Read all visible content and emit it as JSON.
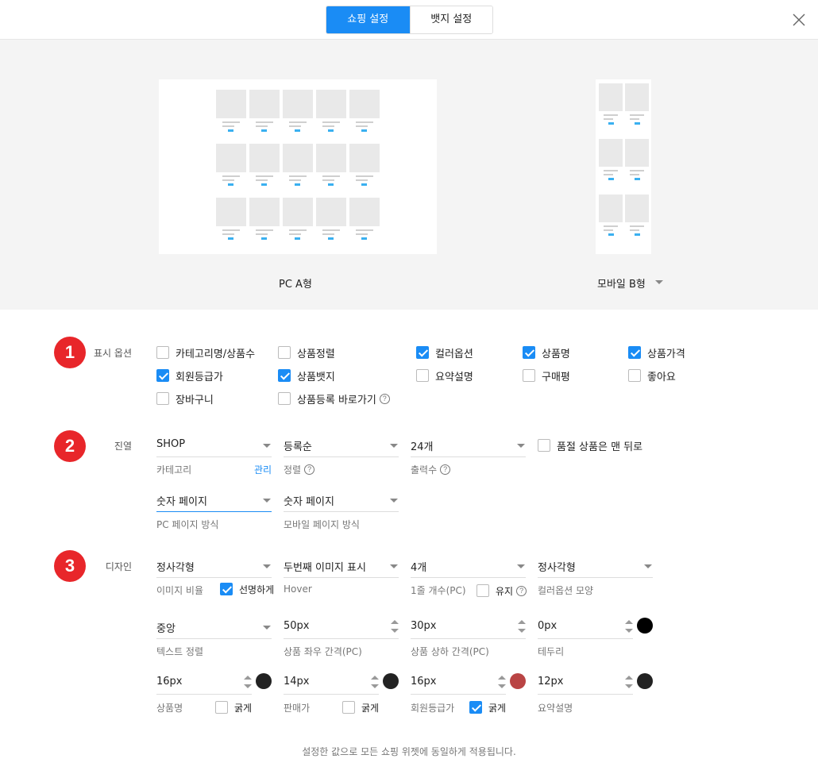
{
  "tabs": [
    {
      "label": "쇼핑 설정",
      "active": true
    },
    {
      "label": "뱃지 설정",
      "active": false
    }
  ],
  "preview": {
    "pc_label": "PC A형",
    "mobile_label": "모바일 B형"
  },
  "section1": {
    "number": "1",
    "title": "표시 옵션",
    "options": [
      {
        "label": "카테고리명/상품수",
        "checked": false
      },
      {
        "label": "상품정렬",
        "checked": false
      },
      {
        "label": "컬러옵션",
        "checked": true
      },
      {
        "label": "상품명",
        "checked": true
      },
      {
        "label": "상품가격",
        "checked": true
      },
      {
        "label": "회원등급가",
        "checked": true
      },
      {
        "label": "상품뱃지",
        "checked": true
      },
      {
        "label": "요약설명",
        "checked": false
      },
      {
        "label": "구매평",
        "checked": false
      },
      {
        "label": "좋아요",
        "checked": false
      },
      {
        "label": "장바구니",
        "checked": false
      },
      {
        "label": "상품등록 바로가기",
        "checked": false
      }
    ]
  },
  "section2": {
    "number": "2",
    "title": "진열",
    "category": {
      "value": "SHOP",
      "label": "카테고리",
      "manage": "관리"
    },
    "sort": {
      "value": "등록순",
      "label": "정렬"
    },
    "count": {
      "value": "24개",
      "label": "출력수"
    },
    "soldout": {
      "label": "품절 상품은 맨 뒤로",
      "checked": false
    },
    "pc_paging": {
      "value": "숫자 페이지",
      "label": "PC 페이지 방식"
    },
    "mobile_paging": {
      "value": "숫자 페이지",
      "label": "모바일 페이지 방식"
    }
  },
  "section3": {
    "number": "3",
    "title": "디자인",
    "ratio": {
      "value": "정사각형",
      "label": "이미지 비율",
      "sharp_label": "선명하게",
      "sharp_checked": true
    },
    "hover": {
      "value": "두번째 이미지 표시",
      "label": "Hover"
    },
    "per_row": {
      "value": "4개",
      "label": "1줄 개수(PC)",
      "keep_label": "유지",
      "keep_checked": false
    },
    "color_shape": {
      "value": "정사각형",
      "label": "컬러옵션 모양"
    },
    "text_align": {
      "value": "중앙",
      "label": "텍스트 정렬"
    },
    "gap_x": {
      "value": "50px",
      "label": "상품 좌우 간격(PC)"
    },
    "gap_y": {
      "value": "30px",
      "label": "상품 상하 간격(PC)"
    },
    "border": {
      "value": "0px",
      "label": "테두리",
      "color": "#000000"
    },
    "name_size": {
      "value": "16px",
      "label": "상품명",
      "bold_label": "굵게",
      "bold": false,
      "color": "#222222"
    },
    "price_size": {
      "value": "14px",
      "label": "판매가",
      "bold_label": "굵게",
      "bold": false,
      "color": "#222222"
    },
    "member_size": {
      "value": "16px",
      "label": "회원등급가",
      "bold_label": "굵게",
      "bold": true,
      "color": "#b94444"
    },
    "summary_size": {
      "value": "12px",
      "label": "요약설명",
      "color": "#222222"
    }
  },
  "footer_note": "설정한 값으로 모든 쇼핑 위젯에 동일하게 적용됩니다.",
  "colors": {
    "accent": "#1a8cf5",
    "badge": "#e8262a"
  }
}
